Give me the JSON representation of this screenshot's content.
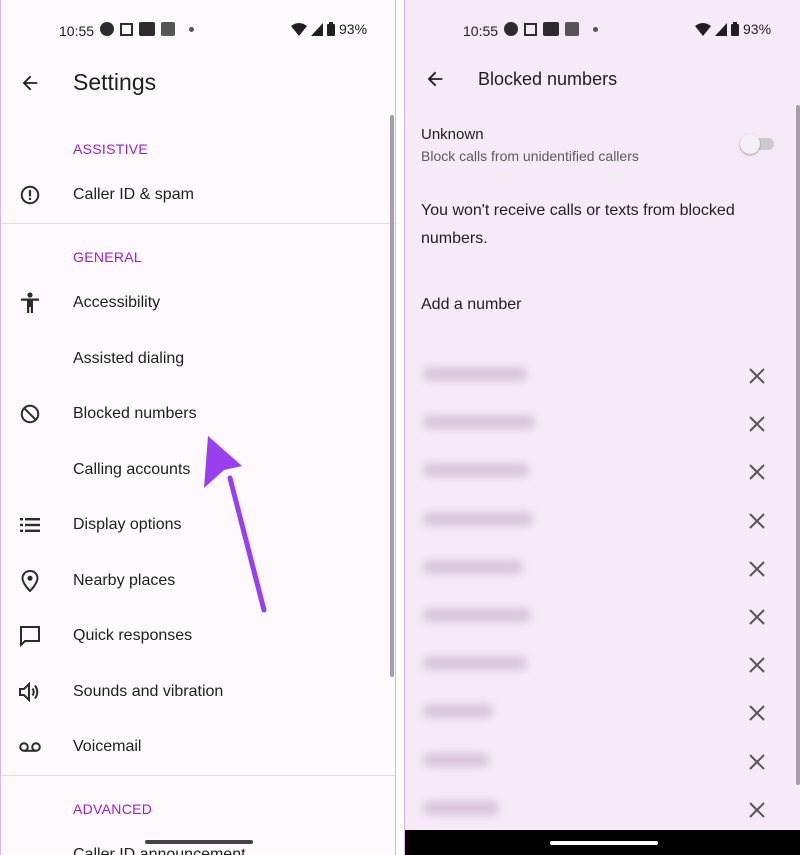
{
  "left": {
    "status": {
      "time": "10:55",
      "battery": "93%"
    },
    "title": "Settings",
    "sections": {
      "assistive": "ASSISTIVE",
      "general": "GENERAL",
      "advanced": "ADVANCED"
    },
    "items": {
      "caller_id": "Caller ID & spam",
      "accessibility": "Accessibility",
      "assisted_dialing": "Assisted dialing",
      "blocked_numbers": "Blocked numbers",
      "calling_accounts": "Calling accounts",
      "display_options": "Display options",
      "nearby_places": "Nearby places",
      "quick_responses": "Quick responses",
      "sounds": "Sounds and vibration",
      "voicemail": "Voicemail",
      "caller_id_announcement": "Caller ID announcement"
    }
  },
  "right": {
    "status": {
      "time": "10:55",
      "battery": "93%"
    },
    "title": "Blocked numbers",
    "unknown": {
      "title": "Unknown",
      "subtitle": "Block calls from unidentified callers",
      "enabled": false
    },
    "info": "You won't receive calls or texts from blocked numbers.",
    "add_number": "Add a number",
    "blocked_count": 10
  },
  "colors": {
    "accent": "#a020c8",
    "arrow": "#9a3ff0"
  }
}
